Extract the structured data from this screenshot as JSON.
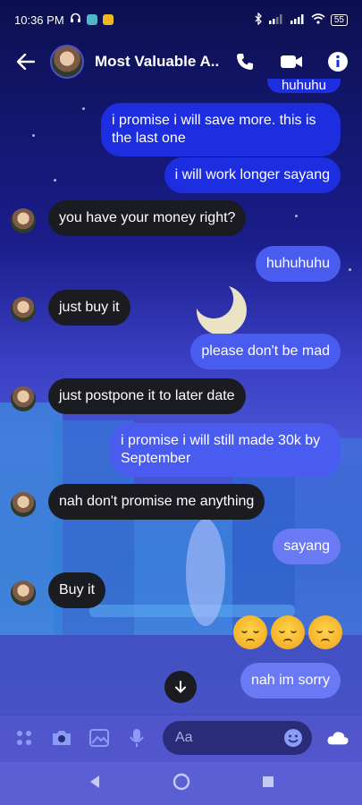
{
  "status_bar": {
    "time": "10:36 PM",
    "battery": "55"
  },
  "header": {
    "chat_name": "Most Valuable A..."
  },
  "messages": [
    {
      "side": "out",
      "text": "huhuhu"
    },
    {
      "side": "out",
      "text": "i promise i will save more. this is the last one"
    },
    {
      "side": "out",
      "text": "i will work longer sayang"
    },
    {
      "side": "in",
      "text": "you have your money right?"
    },
    {
      "side": "out",
      "text": "huhuhuhu"
    },
    {
      "side": "in",
      "text": "just buy it"
    },
    {
      "side": "out",
      "text": "please don't be mad"
    },
    {
      "side": "in",
      "text": "just postpone it to later date"
    },
    {
      "side": "out",
      "text": "i promise i will still made 30k by September"
    },
    {
      "side": "in",
      "text": "nah don't promise me anything"
    },
    {
      "side": "out",
      "text": "sayang"
    },
    {
      "side": "in",
      "text": "Buy it"
    },
    {
      "side": "out",
      "text": "nah im sorry"
    }
  ],
  "emoji_reaction": [
    "pensive-face",
    "pensive-face",
    "pensive-face"
  ],
  "composer": {
    "placeholder": "Aa"
  },
  "colors": {
    "outgoing": "#1c2ee0",
    "incoming": "#1b1b22",
    "accent": "#5a60d4"
  }
}
